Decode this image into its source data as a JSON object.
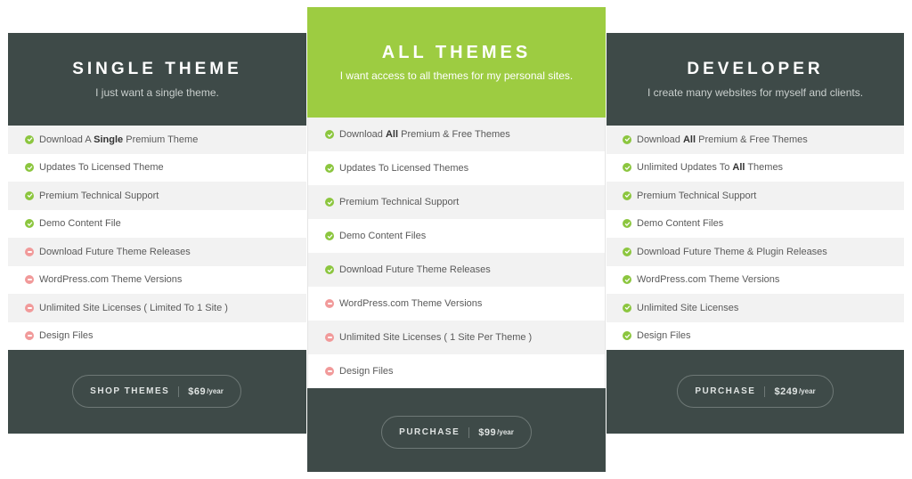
{
  "plans": [
    {
      "title": "SINGLE THEME",
      "subtitle": "I just want a single theme.",
      "features": [
        {
          "included": true,
          "pre": "Download A ",
          "bold": "Single",
          "post": " Premium Theme"
        },
        {
          "included": true,
          "pre": "Updates To Licensed Theme",
          "bold": "",
          "post": ""
        },
        {
          "included": true,
          "pre": "Premium Technical Support",
          "bold": "",
          "post": ""
        },
        {
          "included": true,
          "pre": "Demo Content File",
          "bold": "",
          "post": ""
        },
        {
          "included": false,
          "pre": "Download Future Theme Releases",
          "bold": "",
          "post": ""
        },
        {
          "included": false,
          "pre": "WordPress.com Theme Versions",
          "bold": "",
          "post": ""
        },
        {
          "included": false,
          "pre": "Unlimited Site Licenses ( Limited To 1 Site )",
          "bold": "",
          "post": ""
        },
        {
          "included": false,
          "pre": "Design Files",
          "bold": "",
          "post": ""
        }
      ],
      "button": {
        "label": "SHOP THEMES",
        "price": "$69",
        "period": "/year"
      }
    },
    {
      "title": "ALL THEMES",
      "subtitle": "I want access to all themes for my personal sites.",
      "features": [
        {
          "included": true,
          "pre": "Download ",
          "bold": "All",
          "post": " Premium & Free Themes"
        },
        {
          "included": true,
          "pre": "Updates To Licensed Themes",
          "bold": "",
          "post": ""
        },
        {
          "included": true,
          "pre": "Premium Technical Support",
          "bold": "",
          "post": ""
        },
        {
          "included": true,
          "pre": "Demo Content Files",
          "bold": "",
          "post": ""
        },
        {
          "included": true,
          "pre": "Download Future Theme Releases",
          "bold": "",
          "post": ""
        },
        {
          "included": false,
          "pre": "WordPress.com Theme Versions",
          "bold": "",
          "post": ""
        },
        {
          "included": false,
          "pre": "Unlimited Site Licenses ( 1 Site Per Theme )",
          "bold": "",
          "post": ""
        },
        {
          "included": false,
          "pre": "Design Files",
          "bold": "",
          "post": ""
        }
      ],
      "button": {
        "label": "PURCHASE",
        "price": "$99",
        "period": "/year"
      }
    },
    {
      "title": "DEVELOPER",
      "subtitle": "I create many websites for myself and clients.",
      "features": [
        {
          "included": true,
          "pre": "Download ",
          "bold": "All",
          "post": " Premium & Free Themes"
        },
        {
          "included": true,
          "pre": "Unlimited Updates To ",
          "bold": "All",
          "post": " Themes"
        },
        {
          "included": true,
          "pre": "Premium Technical Support",
          "bold": "",
          "post": ""
        },
        {
          "included": true,
          "pre": "Demo Content Files",
          "bold": "",
          "post": ""
        },
        {
          "included": true,
          "pre": "Download Future Theme & Plugin Releases",
          "bold": "",
          "post": ""
        },
        {
          "included": true,
          "pre": "WordPress.com Theme Versions",
          "bold": "",
          "post": ""
        },
        {
          "included": true,
          "pre": "Unlimited Site Licenses",
          "bold": "",
          "post": ""
        },
        {
          "included": true,
          "pre": "Design Files",
          "bold": "",
          "post": ""
        }
      ],
      "button": {
        "label": "PURCHASE",
        "price": "$249",
        "period": "/year"
      }
    }
  ],
  "icons": {
    "included": "check-circle-icon",
    "excluded": "minus-circle-icon"
  },
  "colors": {
    "dark": "#3e4a48",
    "accent": "#9dcc41",
    "check": "#8cc63f",
    "minus": "#f19a9a"
  }
}
